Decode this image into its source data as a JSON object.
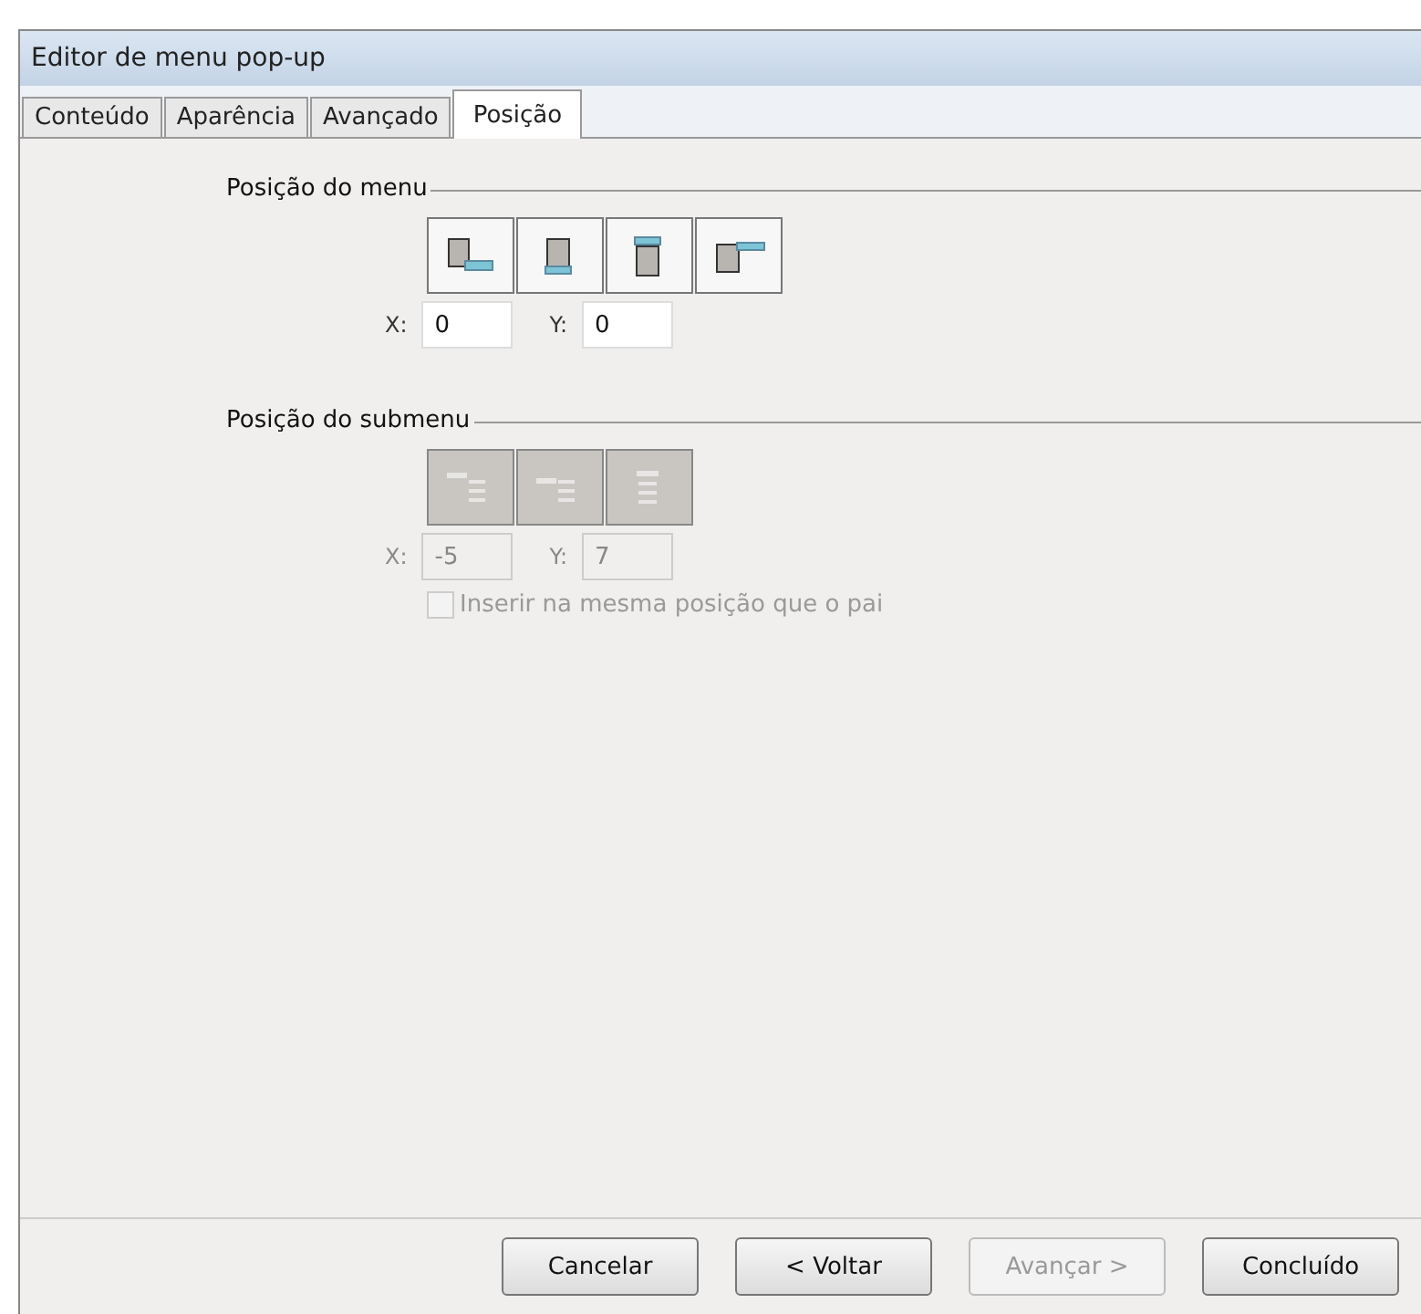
{
  "window": {
    "title": "Editor de menu pop-up"
  },
  "tabs": [
    {
      "label": "Conteúdo",
      "selected": false
    },
    {
      "label": "Aparência",
      "selected": false
    },
    {
      "label": "Avançado",
      "selected": false
    },
    {
      "label": "Posição",
      "selected": true
    }
  ],
  "menu_position": {
    "title": "Posição do menu",
    "disabled": false,
    "options": [
      {
        "kind": "below-right"
      },
      {
        "kind": "below"
      },
      {
        "kind": "above"
      },
      {
        "kind": "right"
      }
    ],
    "x_label": "X:",
    "x_value": "0",
    "y_label": "Y:",
    "y_value": "0"
  },
  "submenu_position": {
    "title": "Posição do submenu",
    "disabled": true,
    "options": [
      {
        "kind": "right-top"
      },
      {
        "kind": "right-middle"
      },
      {
        "kind": "below-list"
      }
    ],
    "x_label": "X:",
    "x_value": "-5",
    "y_label": "Y:",
    "y_value": "7"
  },
  "same_position_checkbox": {
    "label": "Inserir na mesma posição que o pai",
    "checked": false,
    "disabled": true
  },
  "buttons": [
    {
      "label": "Cancelar",
      "disabled": false
    },
    {
      "label": "< Voltar",
      "disabled": false
    },
    {
      "label": "Avançar >",
      "disabled": true
    },
    {
      "label": "Concluído",
      "disabled": false
    }
  ]
}
